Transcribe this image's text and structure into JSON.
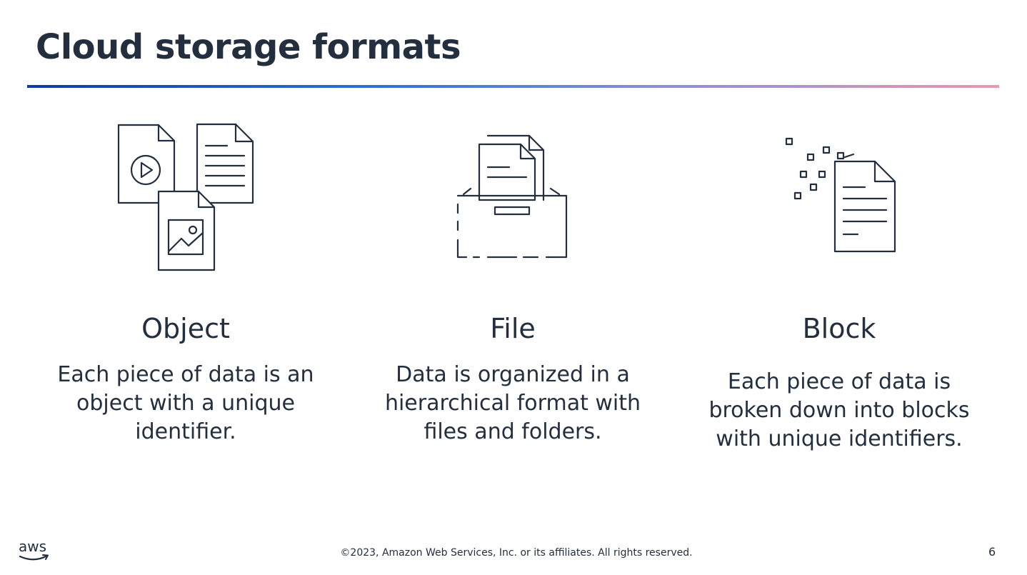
{
  "slide": {
    "title": "Cloud storage formats",
    "page_number": "6"
  },
  "columns": [
    {
      "heading": "Object",
      "description": "Each piece of data is an object with a unique identifier.",
      "icon": "object-storage-icon"
    },
    {
      "heading": "File",
      "description": "Data is organized in a hierarchical format with files and folders.",
      "icon": "file-storage-icon"
    },
    {
      "heading": "Block",
      "description": "Each piece of data is broken down into blocks with unique identifiers.",
      "icon": "block-storage-icon"
    }
  ],
  "footer": {
    "logo_text": "aws",
    "copyright": "©2023, Amazon Web Services, Inc. or its affiliates. All rights reserved."
  },
  "colors": {
    "text": "#232f3e",
    "rule_start": "#0e3b9e",
    "rule_end": "#e59ab0"
  }
}
